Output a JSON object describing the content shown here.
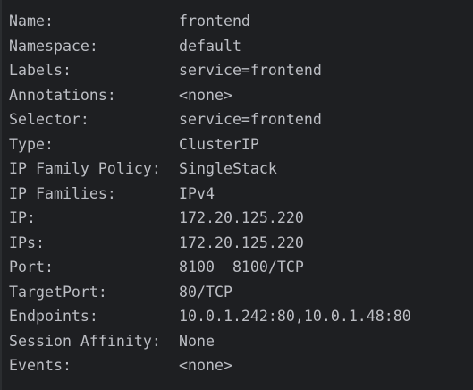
{
  "rows": [
    {
      "key": "Name:",
      "value": "frontend"
    },
    {
      "key": "Namespace:",
      "value": "default"
    },
    {
      "key": "Labels:",
      "value": "service=frontend"
    },
    {
      "key": "Annotations:",
      "value": "<none>"
    },
    {
      "key": "Selector:",
      "value": "service=frontend"
    },
    {
      "key": "Type:",
      "value": "ClusterIP"
    },
    {
      "key": "IP Family Policy:",
      "value": "SingleStack"
    },
    {
      "key": "IP Families:",
      "value": "IPv4"
    },
    {
      "key": "IP:",
      "value": "172.20.125.220"
    },
    {
      "key": "IPs:",
      "value": "172.20.125.220"
    },
    {
      "key": "Port:",
      "value": "8100  8100/TCP"
    },
    {
      "key": "TargetPort:",
      "value": "80/TCP"
    },
    {
      "key": "Endpoints:",
      "value": "10.0.1.242:80,10.0.1.48:80"
    },
    {
      "key": "Session Affinity:",
      "value": "None"
    },
    {
      "key": "Events:",
      "value": "<none>"
    }
  ]
}
